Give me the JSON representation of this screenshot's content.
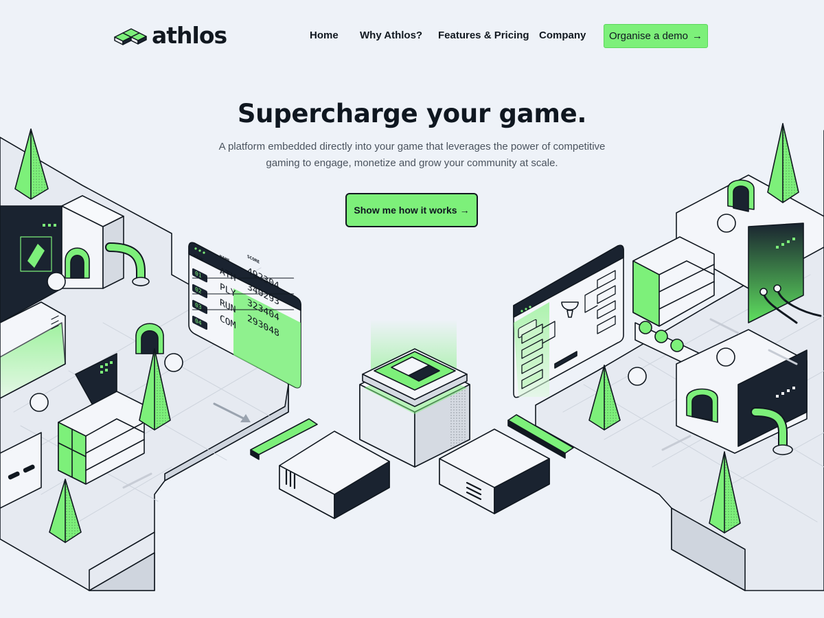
{
  "brand": {
    "name": "athlos"
  },
  "nav": {
    "links": [
      "Home",
      "Why Athlos?",
      "Features & Pricing",
      "Company"
    ],
    "cta_label": "Organise a demo",
    "cta_arrow": "→"
  },
  "hero": {
    "title": "Supercharge your game.",
    "subtitle": "A platform embedded directly into your game that leverages the power of competitive gaming to engage, monetize and grow your community at scale.",
    "cta_label": "Show me how it works",
    "cta_arrow": "→"
  },
  "leaderboard": {
    "headers": [
      "RANK",
      "NAME",
      "SCORE"
    ],
    "rows": [
      {
        "rank": "01",
        "name": "ATH",
        "score": "492304"
      },
      {
        "rank": "02",
        "name": "PLY",
        "score": "340293"
      },
      {
        "rank": "03",
        "name": "RUN",
        "score": "323404"
      },
      {
        "rank": "04",
        "name": "COM",
        "score": "293048"
      }
    ]
  },
  "colors": {
    "accent": "#7df07a",
    "ink": "#111820",
    "background": "#eef2f8"
  }
}
